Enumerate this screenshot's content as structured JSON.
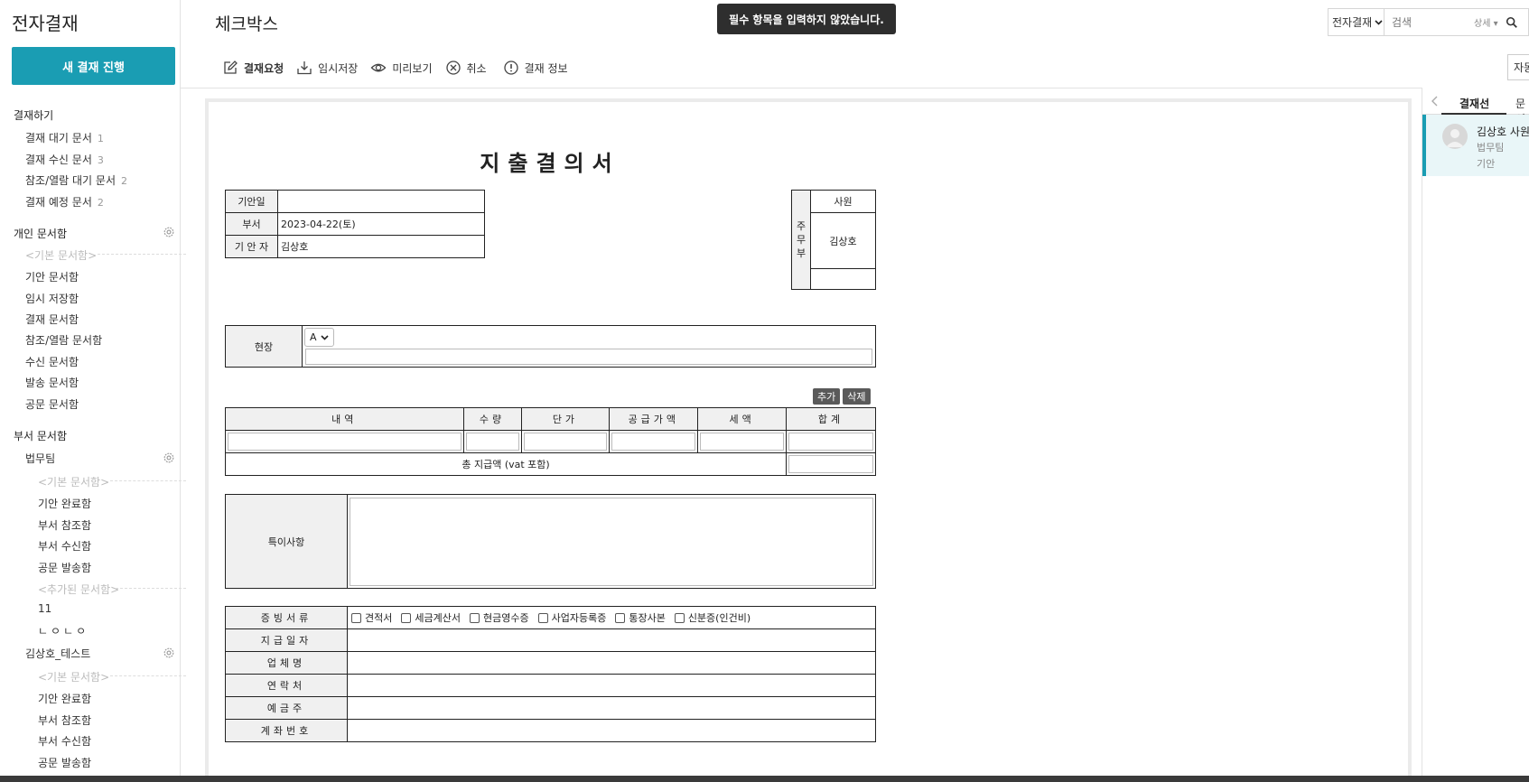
{
  "sidebar": {
    "app_title": "전자결재",
    "new_button": "새 결재 진행",
    "approve_section": "결재하기",
    "approve_items": [
      {
        "label": "결재 대기 문서",
        "count": "1"
      },
      {
        "label": "결재 수신 문서",
        "count": "3"
      },
      {
        "label": "참조/열람 대기 문서",
        "count": "2"
      },
      {
        "label": "결재 예정 문서",
        "count": "2"
      }
    ],
    "personal_section": "개인 문서함",
    "personal_default": "<기본 문서함>",
    "personal_items": [
      "기안 문서함",
      "임시 저장함",
      "결재 문서함",
      "참조/열람 문서함",
      "수신 문서함",
      "발송 문서함",
      "공문 문서함"
    ],
    "dept_section": "부서 문서함",
    "dept1_name": "법무팀",
    "dept1_default": "<기본 문서함>",
    "dept1_items": [
      "기안 완료함",
      "부서 참조함",
      "부서 수신함",
      "공문 발송함"
    ],
    "dept1_added": "<추가된 문서함>",
    "dept1_added_items": [
      "11",
      "ㄴㅇㄴㅇ"
    ],
    "dept2_name": "김상호_테스트",
    "dept2_default": "<기본 문서함>",
    "dept2_items": [
      "기안 완료함",
      "부서 참조함",
      "부서 수신함",
      "공문 발송함"
    ]
  },
  "header": {
    "page_title": "체크박스",
    "toast": "필수 항목을 입력하지 않았습니다.",
    "search_scope": "전자결재",
    "search_placeholder": "검색",
    "search_detail": "상세 ▾"
  },
  "toolbar": {
    "request": "결재요청",
    "temp_save": "임시저장",
    "preview": "미리보기",
    "cancel": "취소",
    "info": "결재 정보",
    "auto": "자동"
  },
  "document": {
    "title": "지출결의서",
    "draft_date_label": "기안일",
    "draft_date_value": "",
    "dept_label": "부서",
    "dept_value": "2023-04-22(토)",
    "drafter_label": "기 안 자",
    "drafter_value": "김상호",
    "approval_vertical": [
      "주",
      "무",
      "부"
    ],
    "approval_position": "사원",
    "approval_name": "김상호",
    "site_label": "현장",
    "site_option": "A",
    "add_button": "추가",
    "delete_button": "삭제",
    "columns": [
      "내역",
      "수량",
      "단가",
      "공급가액",
      "세액",
      "합계"
    ],
    "total_label": "총 지급액 (vat 포함)",
    "memo_label": "특이사항",
    "proof_label": "증빙서류",
    "proof_options": [
      "견적서",
      "세금계산서",
      "현금영수증",
      "사업자등록증",
      "통장사본",
      "신분증(인건비)"
    ],
    "pay_date_label": "지급일자",
    "company_label": "업체명",
    "contact_label": "연락처",
    "depositor_label": "예금주",
    "account_label": "계좌번호"
  },
  "right_panel": {
    "tab_line": "결재선",
    "tab_doc": "문서",
    "name": "김상호 사원",
    "team": "법무팀",
    "role": "기안"
  },
  "colors": {
    "accent": "#1a9db3",
    "toast_bg": "#2e2e2e",
    "label_bg": "#f0f0f0"
  }
}
